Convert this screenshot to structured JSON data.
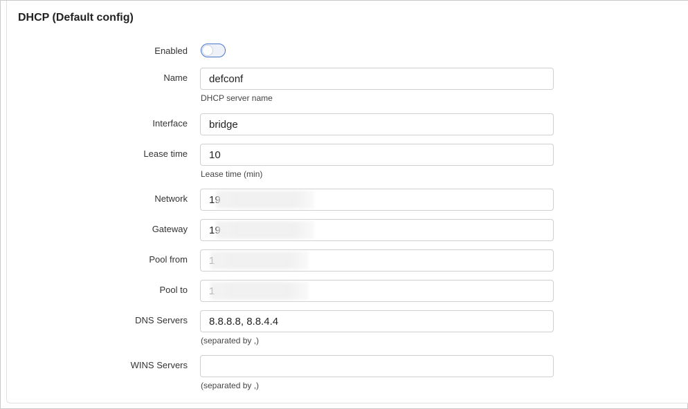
{
  "section": {
    "title": "DHCP (Default config)"
  },
  "fields": {
    "enabled": {
      "label": "Enabled",
      "value": false
    },
    "name": {
      "label": "Name",
      "value": "defconf",
      "help": "DHCP server name"
    },
    "interface": {
      "label": "Interface",
      "value": "bridge"
    },
    "lease_time": {
      "label": "Lease time",
      "value": "10",
      "help": "Lease time (min)"
    },
    "network": {
      "label": "Network",
      "value": "19"
    },
    "gateway": {
      "label": "Gateway",
      "value": "19"
    },
    "pool_from": {
      "label": "Pool from",
      "value": "1"
    },
    "pool_to": {
      "label": "Pool to",
      "value": "1"
    },
    "dns_servers": {
      "label": "DNS Servers",
      "value": "8.8.8.8, 8.8.4.4",
      "help": "(separated by ,)"
    },
    "wins_servers": {
      "label": "WINS Servers",
      "value": "",
      "help": "(separated by ,)"
    }
  },
  "colors": {
    "toggle_border": "#4a74c9",
    "input_border": "#cfcfcf"
  }
}
